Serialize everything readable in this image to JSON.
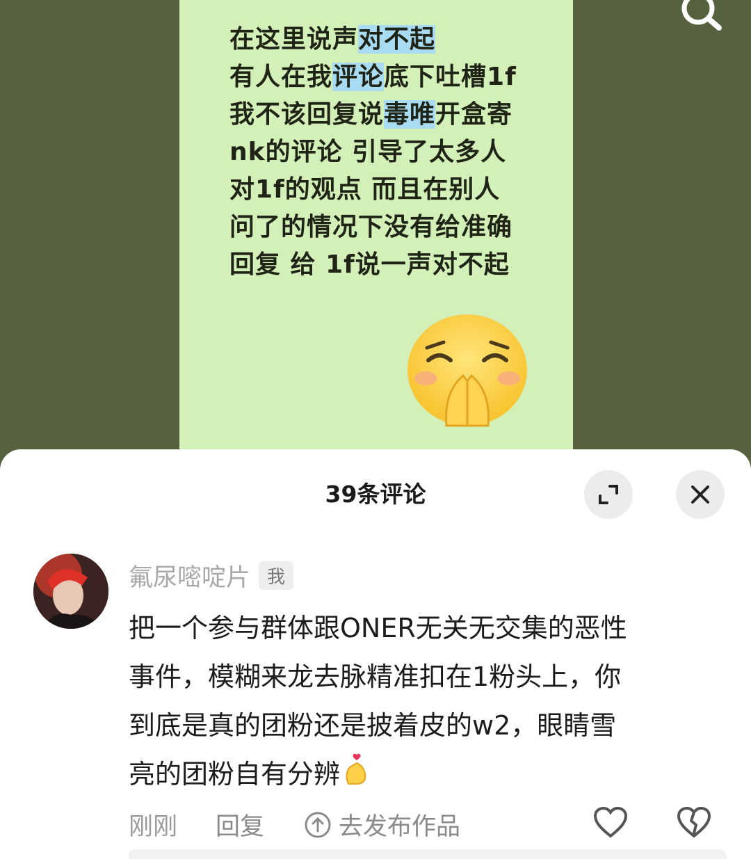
{
  "post": {
    "lines": [
      {
        "pre": "在这里说声",
        "hl": "对不起",
        "post": ""
      },
      {
        "pre": "有人在我",
        "hl": "评论",
        "post": "底下吐槽1f"
      },
      {
        "pre": "我不该回复说",
        "hl": "毒唯",
        "post": "开盒寄"
      },
      {
        "pre": "nk的评论 引导了太多人",
        "hl": "",
        "post": ""
      },
      {
        "pre": "对1f的观点 而且在别人",
        "hl": "",
        "post": ""
      },
      {
        "pre": "问了的情况下没有给准确",
        "hl": "",
        "post": ""
      },
      {
        "pre": "回复 给 1f说一声对不起",
        "hl": "",
        "post": ""
      }
    ],
    "emoji": "pleading-hands-emoji"
  },
  "sheet": {
    "title": "39条评论"
  },
  "comment": {
    "username": "氟尿嘧啶片",
    "badge": "我",
    "lines": [
      "把一个参与群体跟ONER无关无交集的恶性",
      "事件，模糊来龙去脉精准扣在1粉头上，你",
      "到底是真的团粉还是披着皮的w2，眼睛雪",
      "亮的团粉自有分辨"
    ],
    "time": "刚刚",
    "reply_label": "回复",
    "publish_label": "去发布作品"
  },
  "colors": {
    "background": "#55613f",
    "note_card": "#d3f0b8",
    "highlight": "#a9dcf2",
    "sheet": "#ffffff"
  },
  "icons": [
    "search-icon",
    "expand-icon",
    "close-icon",
    "heart-icon",
    "broken-heart-icon",
    "upload-icon",
    "finger-heart-icon"
  ]
}
